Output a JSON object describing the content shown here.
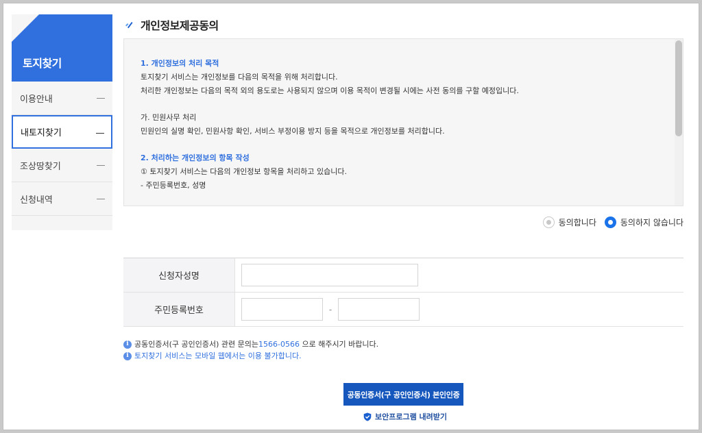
{
  "sidebar": {
    "title": "토지찾기",
    "items": [
      {
        "label": "이용안내",
        "active": false
      },
      {
        "label": "내토지찾기",
        "active": true
      },
      {
        "label": "조상땅찾기",
        "active": false
      },
      {
        "label": "신청내역",
        "active": false
      }
    ]
  },
  "main": {
    "title": "개인정보제공동의",
    "terms": {
      "s1_heading": "1. 개인정보의 처리 목적",
      "s1_line1": "토지찾기 서비스는 개인정보를 다음의 목적을 위해 처리합니다.",
      "s1_line2": "처리한 개인정보는 다음의 목적 외의 용도로는 사용되지 않으며 이용 목적이 변경될 시에는 사전 동의를 구할 예정입니다.",
      "s1_sub": "가. 민원사무 처리",
      "s1_sub_line": "민원인의 실명 확인, 민원사항 확인, 서비스 부정이용 방지 등을 목적으로 개인정보를 처리합니다.",
      "s2_heading": "2. 처리하는 개인정보의 항목 작성",
      "s2_line1": "① 토지찾기 서비스는 다음의 개인정보 항목을 처리하고 있습니다.",
      "s2_line2": "- 주민등록번호, 성명"
    },
    "consent": {
      "agree_label": "동의합니다",
      "disagree_label": "동의하지 않습니다",
      "selected": "disagree"
    },
    "form": {
      "name_label": "신청자성명",
      "name_value": "",
      "rrn_label": "주민등록번호",
      "rrn_front_value": "",
      "rrn_back_value": "",
      "rrn_separator": "-"
    },
    "notes": {
      "note1_prefix": "공동인증서(구 공인인증서) 관련 문의는",
      "note1_phone": "1566-0566",
      "note1_suffix": " 으로 해주시기 바랍니다.",
      "note2": "토지찾기 서비스는 모바일 웹에서는 이용 불가합니다."
    },
    "auth_button": "공동인증서(구 공인인증서) 본인인증",
    "download_link": "보안프로그램 내려받기"
  },
  "icons": {
    "title": "checkmark-icon",
    "info": "info-icon",
    "download": "shield-check-icon"
  },
  "colors": {
    "accent": "#2f6fde",
    "button": "#1657bd",
    "radio_selected": "#1a73e8"
  }
}
